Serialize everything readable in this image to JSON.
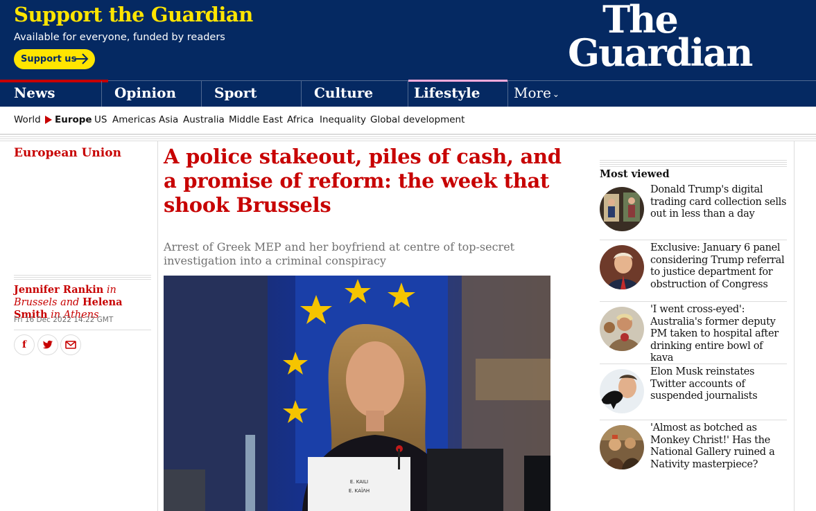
{
  "header": {
    "support_title": "Support the Guardian",
    "support_subtitle": "Available for everyone, funded by readers",
    "support_button": "Support us",
    "logo_line1": "The",
    "logo_line2": "Guardian",
    "colors": {
      "brand_blue": "#052962",
      "support_yellow": "#ffe500",
      "news_red": "#c70000"
    }
  },
  "nav": {
    "pillars": [
      {
        "label": "News",
        "active": true
      },
      {
        "label": "Opinion"
      },
      {
        "label": "Sport"
      },
      {
        "label": "Culture"
      },
      {
        "label": "Lifestyle"
      }
    ],
    "more_label": "More"
  },
  "subnav": {
    "items": [
      "World",
      "Europe",
      "US",
      "Americas",
      "Asia",
      "Australia",
      "Middle East",
      "Africa",
      "Inequality",
      "Global development"
    ],
    "active": "Europe"
  },
  "article": {
    "section": "European Union",
    "headline": "A police stakeout, piles of cash, and a promise of reform: the week that shook Brussels",
    "standfirst": "Arrest of Greek MEP and her boyfriend at centre of top-secret investigation into a criminal conspiracy",
    "byline": {
      "author1": "Jennifer Rankin",
      "loc1": "in Brussels",
      "and": "and",
      "author2": "Helena Smith",
      "loc2": "in Athens"
    },
    "date": "Fri 16 Dec 2022 14.22 GMT",
    "share_icons": [
      "facebook-icon",
      "twitter-icon",
      "email-icon"
    ],
    "photo_placard": [
      "E. KAILI",
      "Ε. ΚΑΪΛΗ"
    ]
  },
  "most_viewed": {
    "title": "Most viewed",
    "items": [
      "Donald Trump's digital trading card collection sells out in less than a day",
      "Exclusive: January 6 panel considering Trump referral to justice department for obstruction of Congress",
      "'I went cross-eyed': Australia's former deputy PM taken to hospital after drinking entire bowl of kava",
      "Elon Musk reinstates Twitter accounts of suspended journalists",
      "'Almost as botched as Monkey Christ!' Has the National Gallery ruined a Nativity masterpiece?"
    ]
  }
}
